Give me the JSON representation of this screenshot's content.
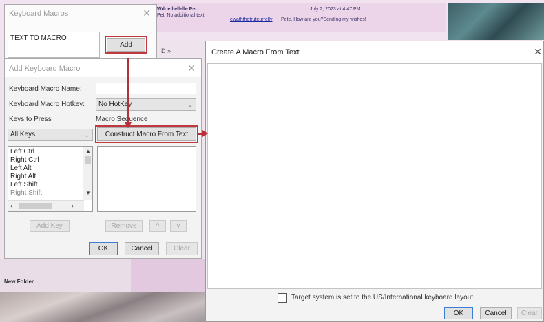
{
  "background": {
    "email_sender": "Wdrielliellelle Pet...",
    "email_preview": "Pet. No additional text",
    "email_date": "July 2, 2023 at 4:47 PM",
    "email_body_link": "ewaththetruteurrelly",
    "email_body": "Pete. How are you?Sending my wishes!",
    "small_tab": "D »",
    "new_folder": "New Folder"
  },
  "keyboard_macros": {
    "title": "Keyboard Macros",
    "macro_item": "TEXT TO MACRO",
    "add_label": "Add"
  },
  "add_macro": {
    "title": "Add Keyboard Macro",
    "name_label": "Keyboard Macro Name:",
    "name_value": "",
    "hotkey_label": "Keyboard Macro Hotkey:",
    "hotkey_value": "No HotKey",
    "keys_label": "Keys to Press",
    "sequence_label": "Macro Sequence",
    "keys_filter": "All Keys",
    "construct_label": "Construct Macro From Text",
    "keys": [
      "Left Ctrl",
      "Right Ctrl",
      "Left Alt",
      "Right Alt",
      "Left Shift",
      "Right Shift"
    ],
    "add_key_label": "Add Key",
    "remove_label": "Remove",
    "up_label": "^",
    "down_label": "v",
    "ok_label": "OK",
    "cancel_label": "Cancel",
    "clear_label": "Clear"
  },
  "create_macro": {
    "title": "Create A Macro From Text",
    "text_value": "",
    "checkbox_label": "Target system is set to the US/International keyboard layout",
    "checkbox_checked": false,
    "ok_label": "OK",
    "cancel_label": "Cancel",
    "clear_label": "Clear"
  },
  "colors": {
    "highlight_red": "#c0393f",
    "arrow_red": "#b5303a",
    "background_pink": "#efe4ee"
  }
}
